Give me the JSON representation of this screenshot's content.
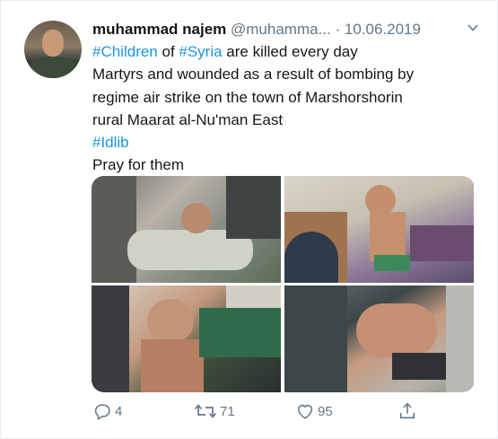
{
  "tweet": {
    "author": {
      "name": "muhammad najem",
      "handle": "@muhamma...",
      "separator": "·",
      "date": "10.06.2019"
    },
    "text": {
      "line1": {
        "hashtag1": "#Children",
        "of": " of ",
        "hashtag2": "#Syria",
        "rest": " are killed every day"
      },
      "line2": "Martyrs and wounded as a result of bombing by",
      "line3": "regime air strike on the town of Marshorshorin",
      "line4": "rural Maarat al-Nu'man East",
      "hashtag_line": "#Idlib",
      "line5": "Pray for them"
    },
    "actions": {
      "reply_count": "4",
      "retweet_count": "71",
      "like_count": "95"
    }
  },
  "icons": {
    "caret": "chevron-down-icon",
    "reply": "reply-icon",
    "retweet": "retweet-icon",
    "like": "heart-icon",
    "share": "share-icon"
  },
  "colors": {
    "hashtag": "#1b95e0",
    "secondary_text": "#657786",
    "primary_text": "#14171a"
  }
}
